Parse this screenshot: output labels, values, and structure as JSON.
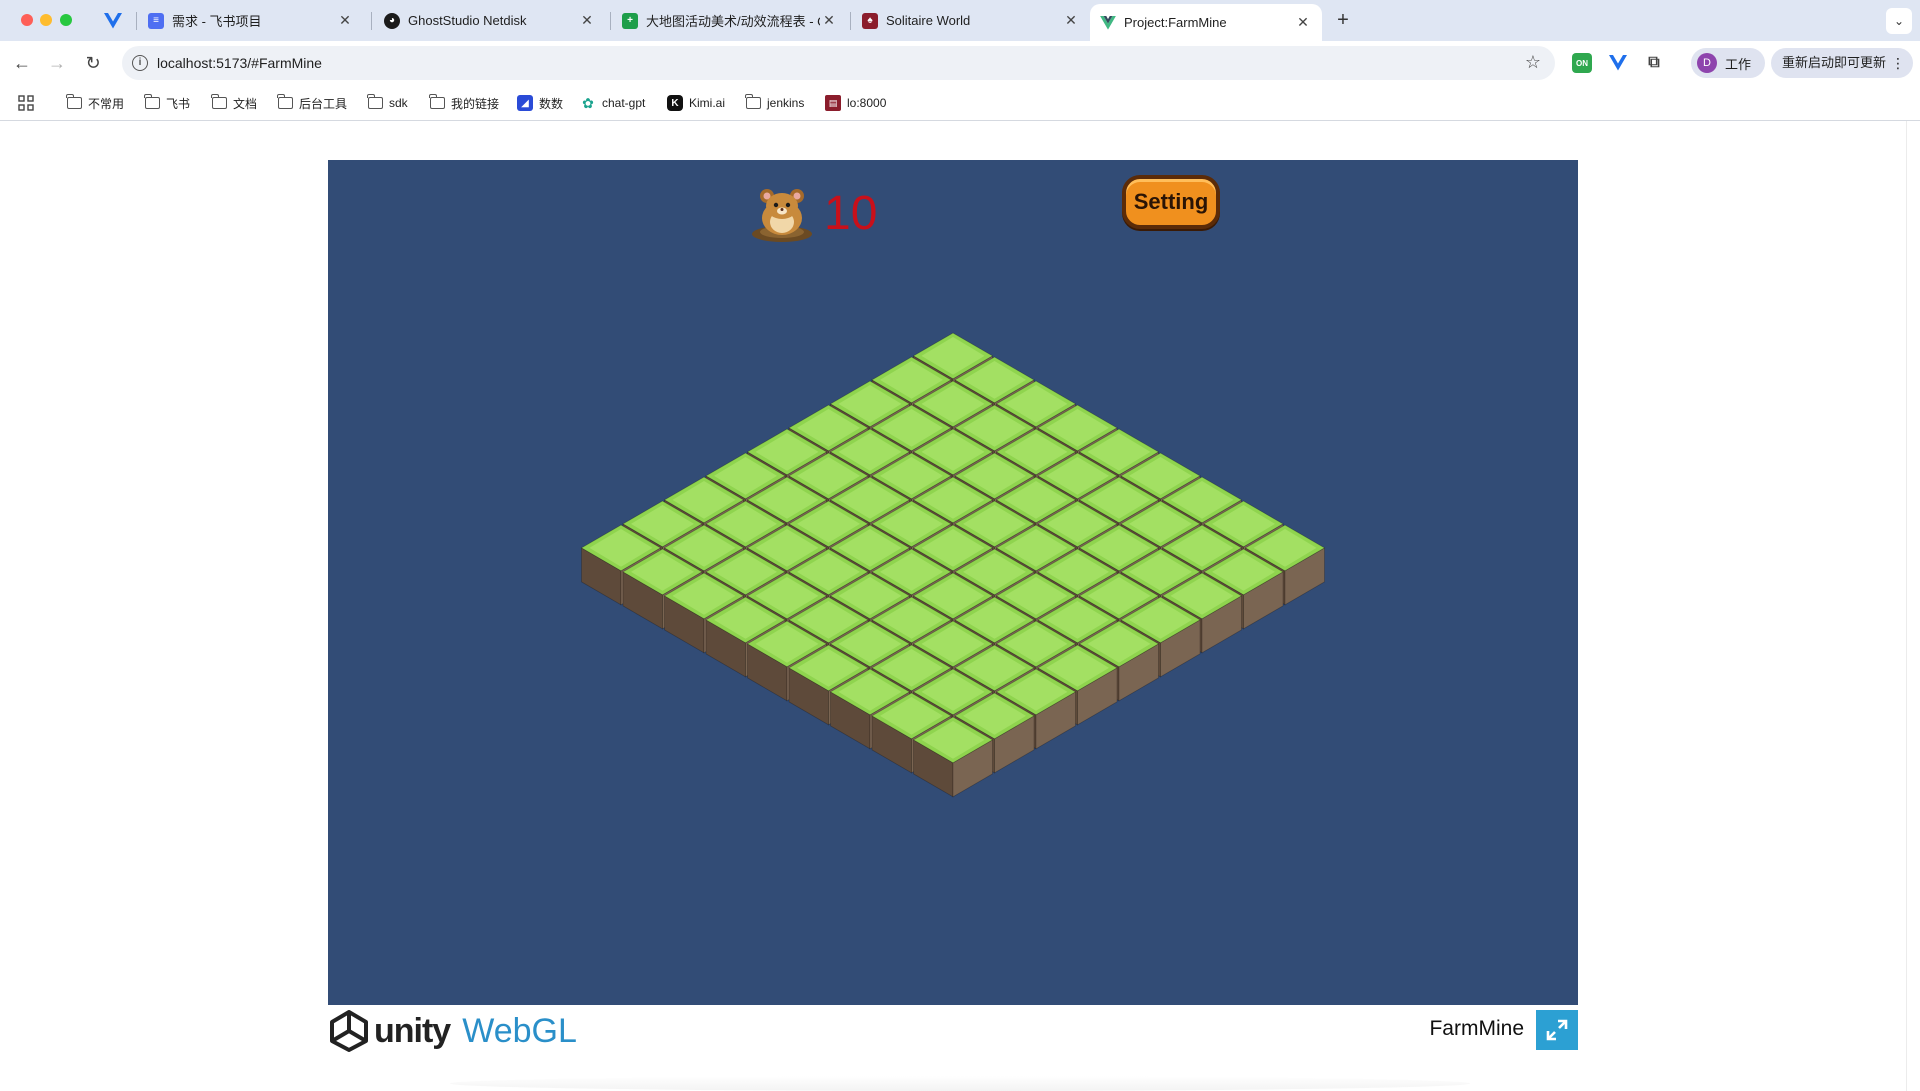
{
  "browser": {
    "tabs": [
      {
        "title": "需求 - 飞书项目",
        "favicon": "feishu-project-icon"
      },
      {
        "title": "GhostStudio Netdisk",
        "favicon": "ghost-icon"
      },
      {
        "title": "大地图活动美术/动效流程表 - G",
        "favicon": "sheets-icon"
      },
      {
        "title": "Solitaire World",
        "favicon": "solitaire-icon"
      },
      {
        "title": "Project:FarmMine",
        "favicon": "vue-icon",
        "active": true
      }
    ],
    "url": "localhost:5173/#FarmMine",
    "profile_initial": "D",
    "profile_label": "工作",
    "update_label": "重新启动即可更新"
  },
  "bookmarks": [
    {
      "label": "不常用",
      "icon": "folder-icon"
    },
    {
      "label": "飞书",
      "icon": "folder-icon"
    },
    {
      "label": "文档",
      "icon": "folder-icon"
    },
    {
      "label": "后台工具",
      "icon": "folder-icon"
    },
    {
      "label": "sdk",
      "icon": "folder-icon"
    },
    {
      "label": "我的链接",
      "icon": "folder-icon"
    },
    {
      "label": "数数",
      "icon": "shushu-icon"
    },
    {
      "label": "chat-gpt",
      "icon": "chatgpt-icon"
    },
    {
      "label": "Kimi.ai",
      "icon": "kimi-icon"
    },
    {
      "label": "jenkins",
      "icon": "folder-icon"
    },
    {
      "label": "lo:8000",
      "icon": "site-icon"
    }
  ],
  "game": {
    "score": "10",
    "setting_label": "Setting",
    "grid_size": 9,
    "tile_top_color": "#8fd44e",
    "tile_left_color": "#5e4a3a",
    "tile_right_color": "#7a6552",
    "background_color": "#324c76",
    "title": "FarmMine"
  },
  "footer": {
    "unity_label": "unity",
    "webgl_label": "WebGL"
  },
  "colors": {
    "accent": "#2ca0d3",
    "score": "#c8101a"
  }
}
